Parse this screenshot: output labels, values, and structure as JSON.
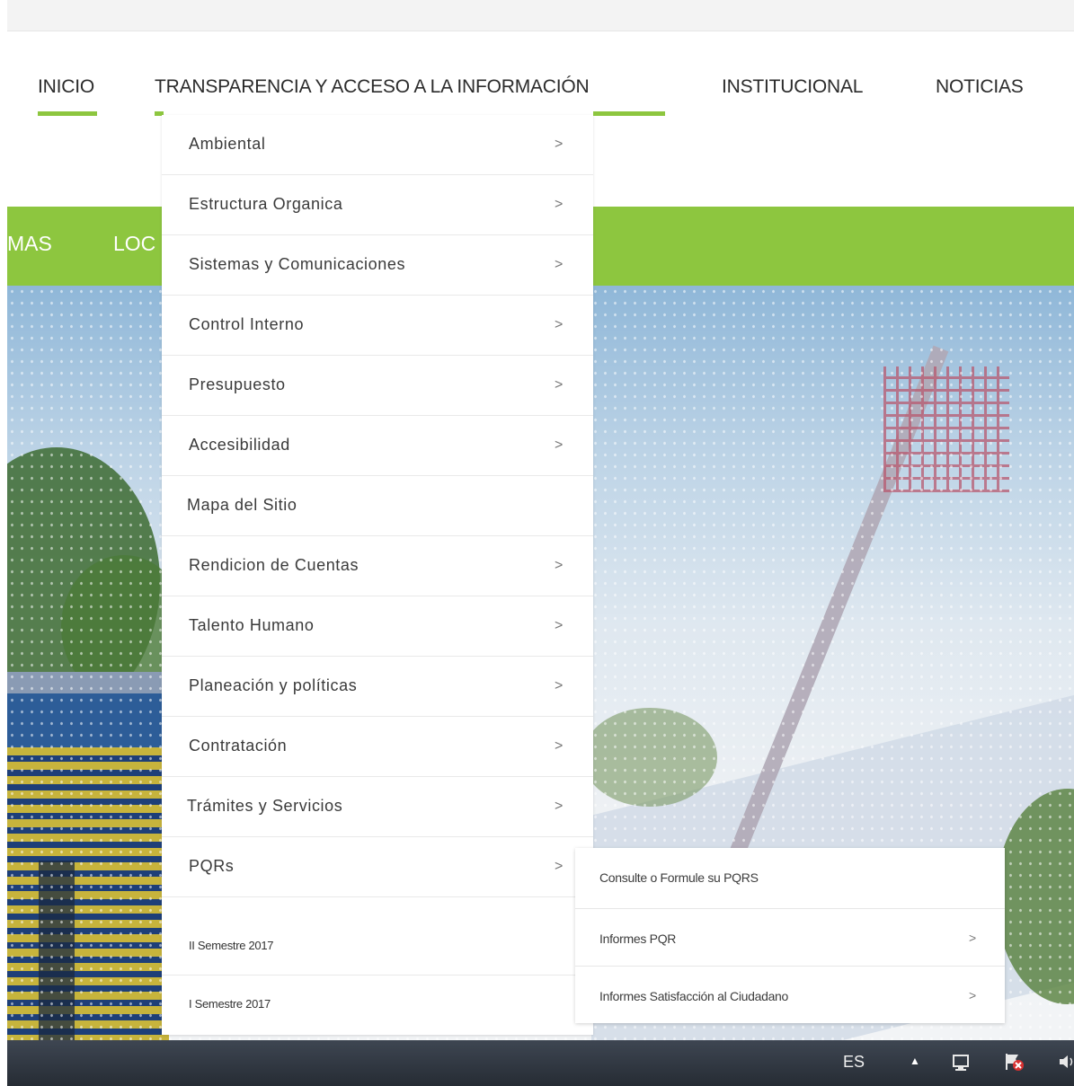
{
  "nav": {
    "items": [
      {
        "label": "INICIO"
      },
      {
        "label": "TRANSPARENCIA Y ACCESO A LA INFORMACIÓN"
      },
      {
        "label": "INSTITUCIONAL"
      },
      {
        "label": "NOTICIAS"
      }
    ],
    "accent_color": "#8dc63f"
  },
  "secondary_nav": {
    "items": [
      {
        "label": "MAS"
      },
      {
        "label": "LOC"
      }
    ]
  },
  "dropdown": {
    "items": [
      {
        "label": "Ambiental",
        "chevron": ">"
      },
      {
        "label": "Estructura Organica",
        "chevron": ">"
      },
      {
        "label": "Sistemas y Comunicaciones",
        "chevron": ">"
      },
      {
        "label": "Control Interno",
        "chevron": ">"
      },
      {
        "label": "Presupuesto",
        "chevron": ">"
      },
      {
        "label": "Accesibilidad",
        "chevron": ">"
      },
      {
        "label": "Mapa del Sitio"
      },
      {
        "label": "Rendicion de Cuentas",
        "chevron": ">"
      },
      {
        "label": "Talento Humano",
        "chevron": ">"
      },
      {
        "label": "Planeación y políticas",
        "chevron": ">"
      },
      {
        "label": "Contratación",
        "chevron": ">"
      },
      {
        "label": "Trámites y Servicios",
        "chevron": ">"
      },
      {
        "label": "PQRs",
        "chevron": ">"
      },
      {
        "label": "II Semestre 2017"
      },
      {
        "label": "I Semestre 2017"
      }
    ]
  },
  "submenu": {
    "items": [
      {
        "label": "Consulte o Formule su PQRS"
      },
      {
        "label": "Informes PQR",
        "chevron": ">"
      },
      {
        "label": "Informes Satisfacción al Ciudadano",
        "chevron": ">"
      }
    ]
  },
  "taskbar": {
    "language": "ES",
    "tray_arrow": "▲",
    "icons": [
      "network-icon",
      "flag-error-icon",
      "speaker-icon"
    ]
  }
}
